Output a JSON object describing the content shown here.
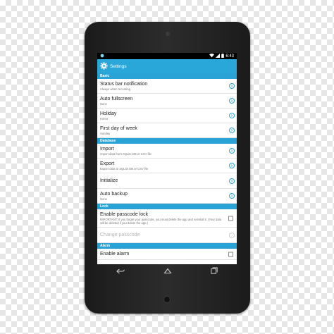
{
  "status_bar": {
    "time": "6:43"
  },
  "app_bar": {
    "title": "Settings"
  },
  "sections": [
    {
      "header": "Basic",
      "items": [
        {
          "title": "Status bar notification",
          "subtitle": "Always when recording",
          "control": "chevron",
          "enabled": true
        },
        {
          "title": "Auto fullscreen",
          "subtitle": "None",
          "control": "chevron",
          "enabled": true
        },
        {
          "title": "Holiday",
          "subtitle": "Korea",
          "control": "chevron",
          "enabled": true
        },
        {
          "title": "First day of week",
          "subtitle": "Sunday",
          "control": "chevron",
          "enabled": true
        }
      ]
    },
    {
      "header": "Database",
      "items": [
        {
          "title": "Import",
          "subtitle": "Import data from SQLite DB or CSV file",
          "control": "chevron",
          "enabled": true
        },
        {
          "title": "Export",
          "subtitle": "Export data to SQLite DB or CSV file",
          "control": "chevron",
          "enabled": true
        },
        {
          "title": "Initialize",
          "subtitle": "",
          "control": "chevron",
          "enabled": true
        },
        {
          "title": "Auto backup",
          "subtitle": "None",
          "control": "chevron",
          "enabled": true
        }
      ]
    },
    {
      "header": "Lock",
      "items": [
        {
          "title": "Enable passcode lock",
          "subtitle": "IMPORTANT: If you forget your passcode, you must delete the app and reinstall it. (Your data will be deleted if you delete the app.)",
          "control": "checkbox",
          "enabled": true
        },
        {
          "title": "Change passcode",
          "subtitle": "",
          "control": "chevron",
          "enabled": false
        }
      ]
    },
    {
      "header": "Alarm",
      "items": [
        {
          "title": "Enable alarm",
          "subtitle": "",
          "control": "checkbox",
          "enabled": true
        }
      ]
    }
  ],
  "icons": {
    "status_left": "app-notification-icon",
    "wifi": "wifi-icon",
    "signal": "signal-icon",
    "battery": "battery-icon",
    "settings": "gear-icon",
    "chevron": "chevron-right-icon",
    "nav_back": "back-icon",
    "nav_home": "home-icon",
    "nav_recents": "recents-icon"
  },
  "colors": {
    "accent": "#2aa7d9",
    "section_header": "#29a3d6",
    "device_body": "#1f1f1f"
  }
}
